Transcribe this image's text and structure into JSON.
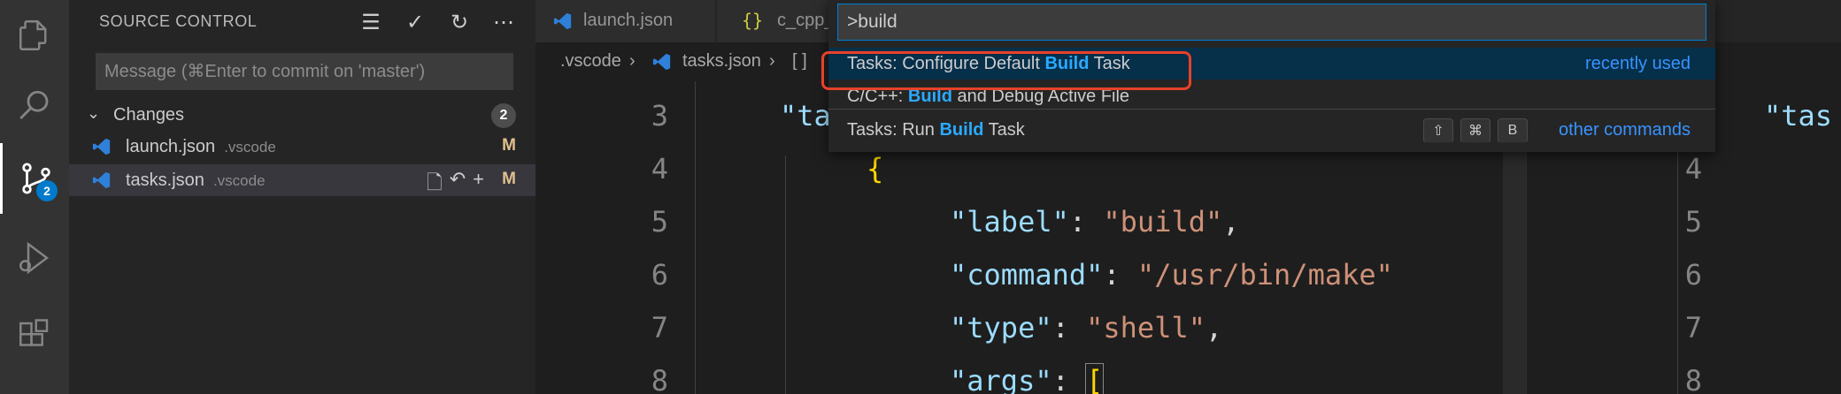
{
  "activity_bar": {
    "icons": [
      "explorer-icon",
      "search-icon",
      "source-control-icon",
      "run-debug-icon",
      "extensions-icon"
    ],
    "source_control_badge": "2"
  },
  "sidebar": {
    "title": "SOURCE CONTROL",
    "actions": [
      "view-as-tree-icon",
      "commit-check-icon",
      "refresh-icon",
      "more-actions-icon"
    ],
    "commit_placeholder": "Message (⌘Enter to commit on 'master')",
    "changes_label": "Changes",
    "changes_count": "2",
    "files": [
      {
        "name": "launch.json",
        "dir": ".vscode",
        "status": "M"
      },
      {
        "name": "tasks.json",
        "dir": ".vscode",
        "status": "M"
      }
    ]
  },
  "tabs": [
    {
      "label": "launch.json"
    },
    {
      "label": "c_cpp_"
    }
  ],
  "breadcrumb": {
    "folder": ".vscode",
    "file": "tasks.json",
    "symbol": "[ ]"
  },
  "editor": {
    "lines": [
      {
        "num": "3",
        "text": "\"ta"
      },
      {
        "num": "4",
        "text": "{"
      },
      {
        "num": "5",
        "key": "\"label\"",
        "value": "\"build\""
      },
      {
        "num": "6",
        "key": "\"command\"",
        "value": "\"/usr/bin/make\""
      },
      {
        "num": "7",
        "key": "\"type\"",
        "value": "\"shell\""
      },
      {
        "num": "8",
        "key": "\"args\"",
        "value": "["
      }
    ],
    "split_line_numbers": [
      "4",
      "5",
      "6",
      "7",
      "8"
    ],
    "split_peek_text": "\"tas"
  },
  "palette": {
    "query": ">build",
    "items": [
      {
        "prefix": "Tasks: Configure Default ",
        "match": "Build",
        "suffix": " Task",
        "right": "recently used"
      },
      {
        "prefix": "C/C++: ",
        "match": "Build",
        "suffix": " and Debug Active File",
        "right": ""
      },
      {
        "prefix": "Tasks: Run ",
        "match": "Build",
        "suffix": " Task",
        "right": "other commands",
        "keys": [
          "⇧",
          "⌘",
          "B"
        ]
      }
    ]
  },
  "colors": {
    "accent": "#007acc",
    "highlight": "#2aaaff",
    "annotation": "#e8412a",
    "modified": "#e2c08d"
  }
}
